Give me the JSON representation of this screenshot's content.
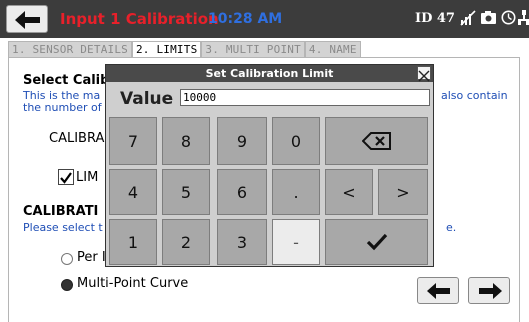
{
  "header": {
    "title": "Input 1 Calibration",
    "time": "10:28 AM",
    "device_id": "ID 47",
    "icons": [
      "back-arrow-icon",
      "signal-off-icon",
      "camera-icon",
      "clock-icon",
      "network-icon"
    ]
  },
  "tabs": [
    {
      "label": "1. SENSOR DETAILS",
      "active": false
    },
    {
      "label": "2. LIMITS",
      "active": true
    },
    {
      "label": "3. MULTI POINT",
      "active": false
    },
    {
      "label": "4. NAME",
      "active": false
    }
  ],
  "content": {
    "section1_heading": "Select Calib",
    "section1_desc_line1": "This is the ma",
    "section1_desc_line2": "the number of",
    "section1_desc_right": "also contain",
    "calibration_label": "CALIBRA",
    "limit_checkbox_label": "LIM",
    "limit_checked": true,
    "section2_heading": "CALIBRATI",
    "section2_desc": "Please select t",
    "section2_desc_right": "e.",
    "radio_per_label": "Per I",
    "radio_multipoint_label": "Multi-Point Curve",
    "selected_radio": "Multi-Point Curve"
  },
  "modal": {
    "title": "Set Calibration Limit",
    "value_label": "Value",
    "value": "10000",
    "keys": [
      "7",
      "8",
      "9",
      "0",
      "4",
      "5",
      "6",
      ".",
      "<",
      ">",
      "1",
      "2",
      "3",
      "-"
    ],
    "backspace_icon": "backspace-icon",
    "enter_icon": "checkmark-icon"
  },
  "colors": {
    "header_bg": "#3c3c3c",
    "title_red": "#e8202a",
    "time_blue": "#2f6fe0",
    "desc_blue": "#1f4eb5",
    "key_gray": "#a8a8a8"
  }
}
